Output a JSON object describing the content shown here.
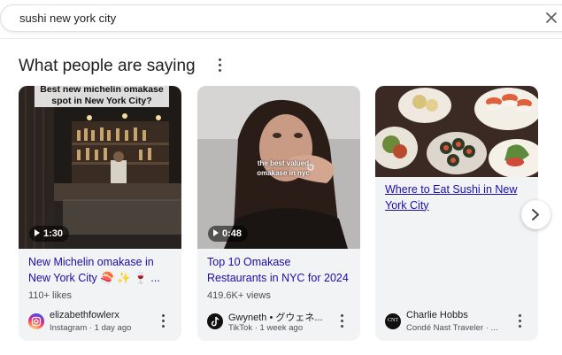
{
  "search": {
    "query": "sushi new york city"
  },
  "section": {
    "heading": "What people are saying"
  },
  "cards": [
    {
      "overlay_text": "Best new michelin omakase spot in New York City?",
      "duration": "1:30",
      "title": "New Michelin omakase in New York City 🍣 ✨ 🍷 ...",
      "meta": "110+ likes",
      "author": "elizabethfowlerx",
      "source": "Instagram · 1 day ago",
      "platform_icon": "instagram-icon"
    },
    {
      "overlay_text": "the best valued omakase in nyc",
      "duration": "0:48",
      "title": "Top 10 Omakase Restaurants in NYC for 2024",
      "meta": "419.6K+ views",
      "author": "Gwyneth • グウェネ...",
      "source": "TikTok · 1 week ago",
      "platform_icon": "tiktok-icon"
    },
    {
      "title": "Where to Eat Sushi in New York City",
      "author": "Charlie Hobbs",
      "source": "Condé Nast Traveler · ...",
      "platform_icon": "cnt-icon",
      "platform_label": "CNT"
    }
  ],
  "colors": {
    "link": "#1a0dab",
    "card_bg": "#f1f3f4"
  }
}
